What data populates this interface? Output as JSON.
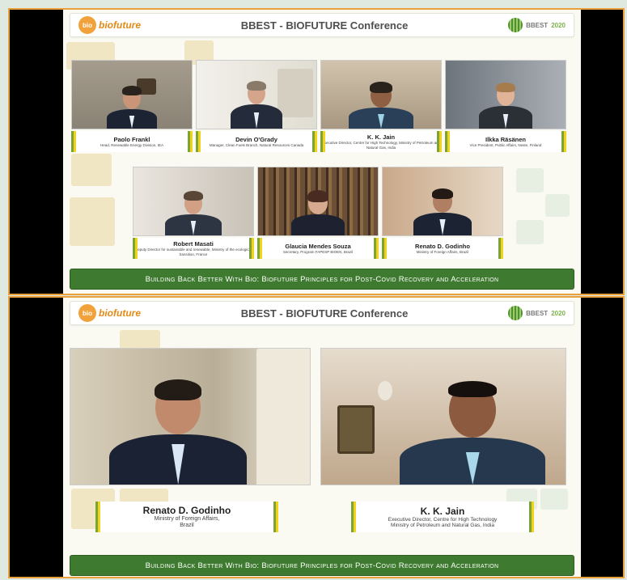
{
  "conference": {
    "logo_text": "biofuture",
    "logo_badge": "bio",
    "title": "BBEST - BIOFUTURE Conference",
    "bbest_label": "BBEST",
    "bbest_year": "2020",
    "banner": "Building Back Better With Bio: Biofuture Principles for Post-Covid Recovery and Acceleration"
  },
  "top_panel": {
    "participants": [
      {
        "name": "Paolo Frankl",
        "role": "Head, Renewable Energy Division, IEA"
      },
      {
        "name": "Devin O'Grady",
        "role": "Manager, Clean Fuels Branch, Natural Resources Canada"
      },
      {
        "name": "K. K. Jain",
        "role": "Executive Director, Centre for High Technology, Ministry of Petroleum and Natural Gas, India"
      },
      {
        "name": "Ilkka Räsänen",
        "role": "Vice President, Public Affairs, Neste, Finland"
      },
      {
        "name": "Robert Masati",
        "role": "Deputy Director for sustainable and renewable, Ministry of the ecological transition, France"
      },
      {
        "name": "Glaucia Mendes Souza",
        "role": "Secretary, Program FAPESP BIOEN, Brazil"
      },
      {
        "name": "Renato D. Godinho",
        "role": "Ministry of Foreign Affairs, Brazil"
      }
    ]
  },
  "bottom_panel": {
    "participants": [
      {
        "name": "Renato D. Godinho",
        "role_line1": "Ministry of Foreign Affairs,",
        "role_line2": "Brazil"
      },
      {
        "name": "K. K. Jain",
        "role_line1": "Executive Director, Centre for High Technology",
        "role_line2": "Ministry of Petroleum and Natural Gas, India"
      }
    ]
  },
  "colors": {
    "frame_border": "#e8a13c",
    "banner_green": "#3e7a2f",
    "accent_yellow": "#f2d21a",
    "accent_green": "#7aa33a",
    "logo_orange": "#f2a23a"
  },
  "icons": [
    "biofuture-logo-icon",
    "bbest-globe-icon"
  ]
}
